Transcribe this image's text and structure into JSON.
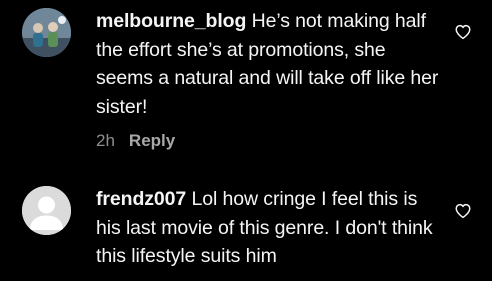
{
  "comments": [
    {
      "username": "melbourne_blog",
      "text": "He’s not making half the effort she’s at promotions, she seems a natural and will take off like her sister!",
      "time": "2h",
      "reply_label": "Reply",
      "avatar_icon": "profile-photo",
      "like_icon": "heart-outline-icon"
    },
    {
      "username": "frendz007",
      "text": "Lol how cringe I feel this is his last movie of this genre. I don't think this lifestyle suits him",
      "avatar_icon": "default-avatar-icon",
      "like_icon": "heart-outline-icon"
    }
  ],
  "colors": {
    "background": "#000000",
    "text": "#f5f5f5",
    "secondary": "#8e8e8e",
    "default_avatar": "#dbdbdb"
  }
}
